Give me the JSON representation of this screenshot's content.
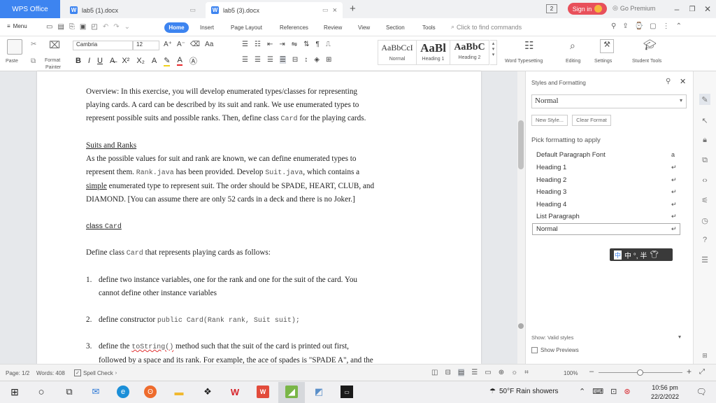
{
  "titlebar": {
    "app_name": "WPS Office",
    "tabs": [
      {
        "label": "lab5 (1).docx"
      },
      {
        "label": "lab5 (3).docx"
      }
    ],
    "new_tab": "+",
    "badge": "2",
    "sign_in": "Sign in",
    "premium": "Go Premium"
  },
  "menubar": {
    "menu": "Menu",
    "tabs": [
      "Home",
      "Insert",
      "Page Layout",
      "References",
      "Review",
      "View",
      "Section",
      "Tools"
    ],
    "search_placeholder": "Click to find commands"
  },
  "ribbon": {
    "paste": "Paste",
    "format_painter_1": "Format",
    "format_painter_2": "Painter",
    "font_name": "Cambria",
    "font_size": "12",
    "styles": [
      {
        "preview": "AaBbCcI",
        "name": "Normal"
      },
      {
        "preview": "AaBl",
        "name": "Heading 1"
      },
      {
        "preview": "AaBbC",
        "name": "Heading 2"
      }
    ],
    "word_typesetting": "Word Typesetting",
    "editing": "Editing",
    "settings": "Settings",
    "student_tools": "Student Tools"
  },
  "document": {
    "overview_1": "Overview: In this exercise, you will develop enumerated types/classes for representing",
    "overview_2": "playing cards. A card can be described by its suit and rank. We use enumerated types to",
    "overview_3a": "represent possible suits and possible ranks. Then, define class ",
    "overview_3code": "Card",
    "overview_3b": " for the playing cards.",
    "suits_heading": "Suits and Ranks",
    "suits_1": "As the possible values for suit and rank are known, we can define enumerated types to",
    "suits_2a": "represent them. ",
    "suits_2code1": "Rank.java",
    "suits_2b": " has been provided. Develop ",
    "suits_2code2": "Suit.java",
    "suits_2c": ", which contains a",
    "suits_3a": "simple",
    "suits_3b": " enumerated type to represent suit. The order should be SPADE, HEART, CLUB, and",
    "suits_4": "DIAMOND. [You can assume there are only 52 cards in a deck and there is no Joker.]",
    "class_label": "class ",
    "class_code": "Card",
    "define_a": "Define class ",
    "define_code": "Card",
    "define_b": " that represents playing cards as follows:",
    "item1_num": "1.",
    "item1_a": "define two instance variables, one for the rank and one for the suit of the card. You",
    "item1_b": "cannot define other instance variables",
    "item2_num": "2.",
    "item2_a": "define constructor ",
    "item2_code": "public Card(Rank rank, Suit suit);",
    "item3_num": "3.",
    "item3_a": "define the ",
    "item3_code": "toString()",
    "item3_b": " method such that the suit of the card is printed out first,",
    "item3_c": "followed by a space and its rank. For example, the ace of spades is \"SPADE A\", and the"
  },
  "styles_panel": {
    "title": "Styles and Formatting",
    "current_style": "Normal",
    "new_style": "New Style...",
    "clear_format": "Clear Format",
    "pick_label": "Pick formatting to apply",
    "items": [
      {
        "label": "Default Paragraph Font",
        "mark": "a"
      },
      {
        "label": "Heading 1",
        "mark": "↵"
      },
      {
        "label": "Heading 2",
        "mark": "↵"
      },
      {
        "label": "Heading 3",
        "mark": "↵"
      },
      {
        "label": "Heading 4",
        "mark": "↵"
      },
      {
        "label": "List Paragraph",
        "mark": "↵"
      },
      {
        "label": "Normal",
        "mark": "↵"
      }
    ],
    "show_label": "Show:",
    "show_value": "Valid styles",
    "show_previews": "Show Previews",
    "ime": "中 °, 半"
  },
  "statusbar": {
    "page": "Page: 1/2",
    "words": "Words: 408",
    "spell": "Spell Check",
    "zoom": "100%"
  },
  "taskbar": {
    "weather": "50°F  Rain showers",
    "time": "10:56 pm",
    "date": "22/2/2022"
  },
  "colors": {
    "accent": "#3d84f0",
    "sign_in": "#e8505b"
  }
}
